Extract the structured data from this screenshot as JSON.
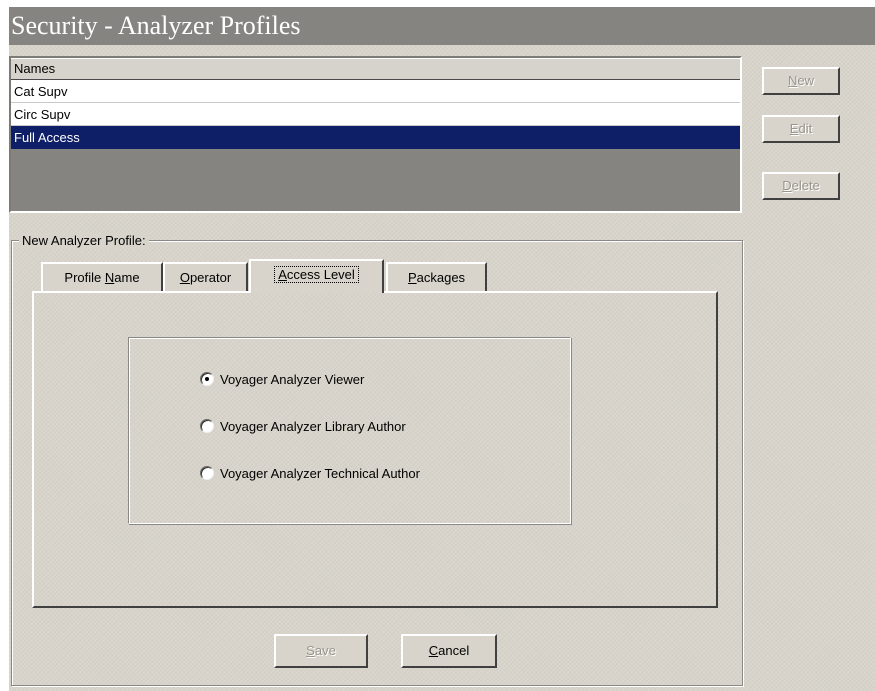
{
  "window": {
    "title": "Security - Analyzer Profiles"
  },
  "names_list": {
    "header": "Names",
    "rows": [
      {
        "label": "Cat Supv",
        "selected": false
      },
      {
        "label": "Circ Supv",
        "selected": false
      },
      {
        "label": "Full Access",
        "selected": true
      }
    ]
  },
  "side_buttons": {
    "new": {
      "label": "New",
      "mnemonic": "N",
      "rest": "ew",
      "enabled": false
    },
    "edit": {
      "label": "Edit",
      "mnemonic": "E",
      "rest": "dit",
      "enabled": false
    },
    "delete": {
      "label": "Delete",
      "mnemonic": "D",
      "rest": "elete",
      "enabled": false
    }
  },
  "profile_group": {
    "legend": "New Analyzer Profile:",
    "tabs": [
      {
        "label": "Profile Name",
        "pre": "Profile ",
        "mnemonic": "N",
        "post": "ame",
        "active": false
      },
      {
        "label": "Operator",
        "pre": "",
        "mnemonic": "O",
        "post": "perator",
        "active": false
      },
      {
        "label": "Access Level",
        "pre": "",
        "mnemonic": "A",
        "post": "ccess Level",
        "active": true
      },
      {
        "label": "Packages",
        "pre": "",
        "mnemonic": "P",
        "post": "ackages",
        "active": false
      }
    ],
    "access_levels": [
      {
        "label": "Voyager Analyzer Viewer",
        "checked": true
      },
      {
        "label": "Voyager Analyzer Library Author",
        "checked": false
      },
      {
        "label": "Voyager Analyzer Technical Author",
        "checked": false
      }
    ]
  },
  "footer_buttons": {
    "save": {
      "label": "Save",
      "mnemonic": "S",
      "rest": "ave",
      "enabled": false
    },
    "cancel": {
      "label": "Cancel",
      "mnemonic": "C",
      "rest": "ancel",
      "enabled": true
    }
  },
  "colors": {
    "title_bar": "#868480",
    "selection": "#0e1f68",
    "face": "#d8d4cb"
  }
}
